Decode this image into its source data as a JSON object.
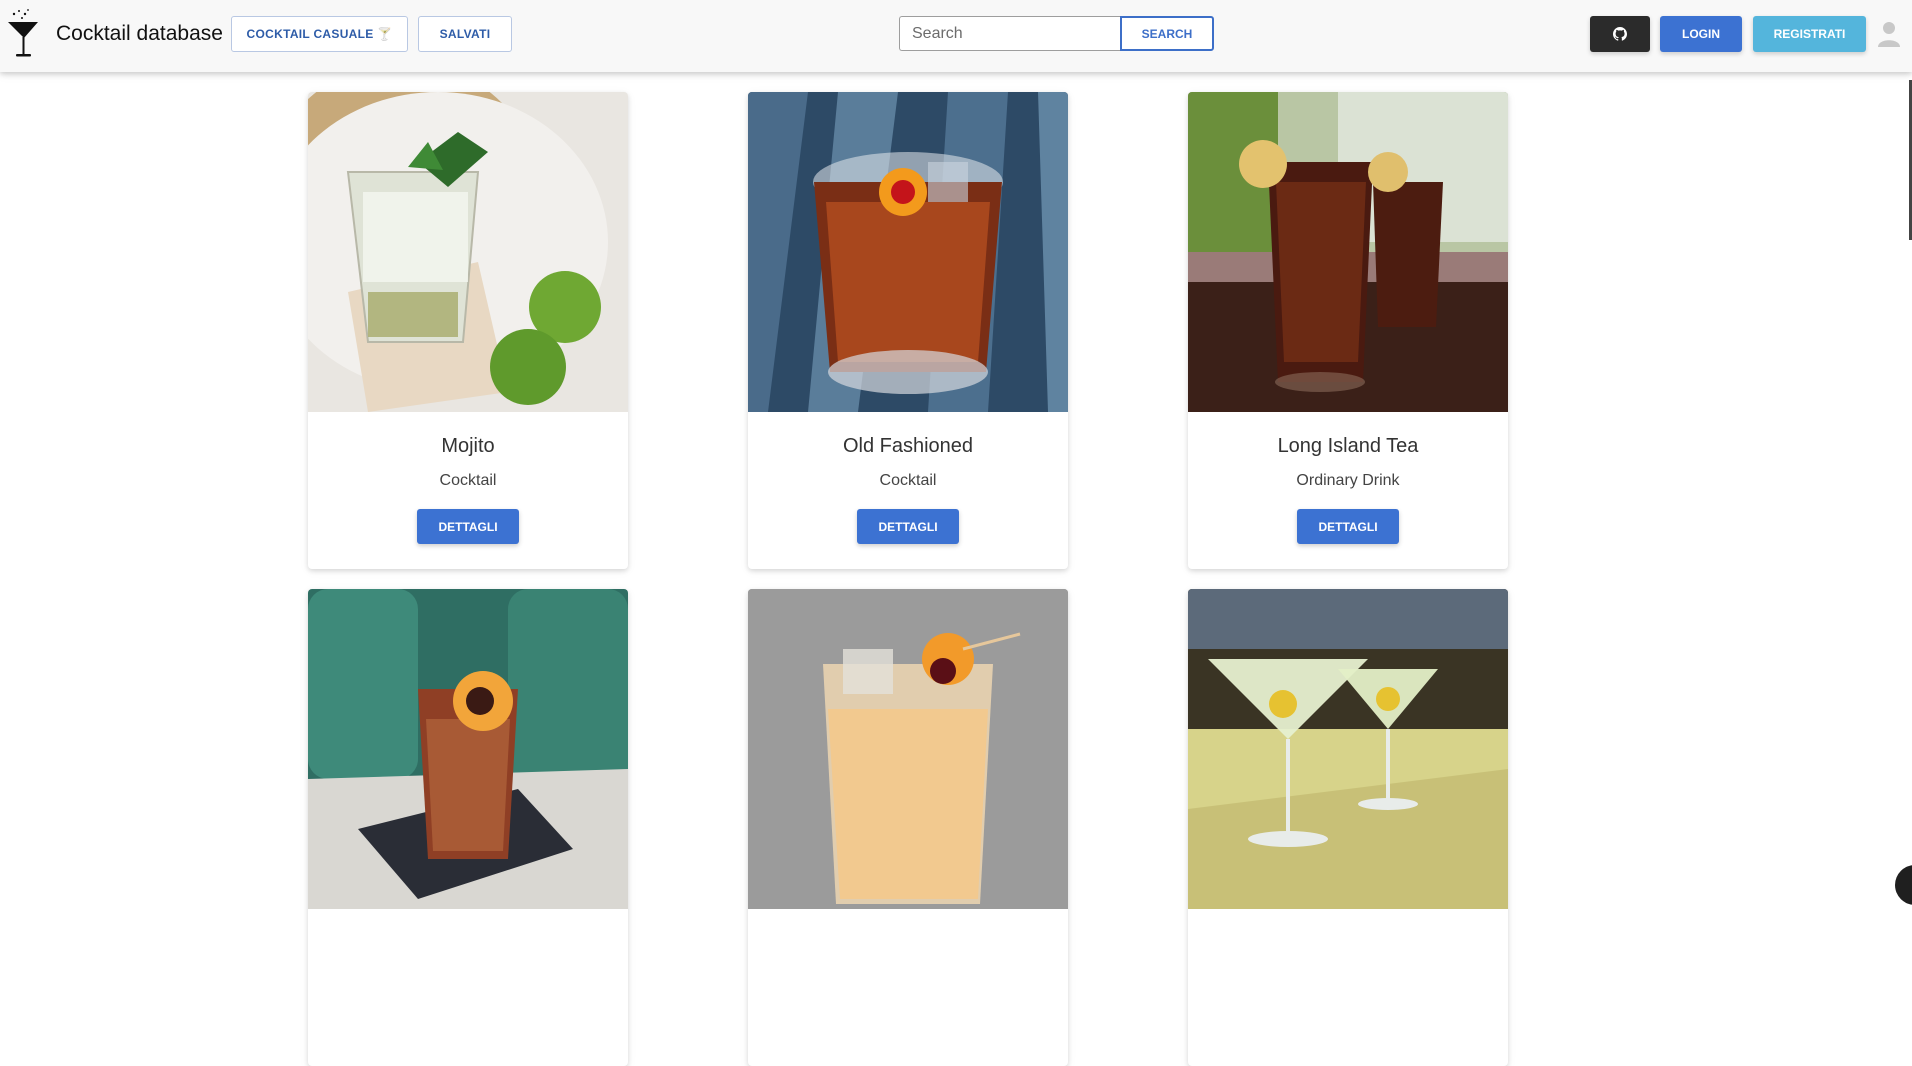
{
  "navbar": {
    "brand_title": "Cocktail database",
    "random_label": "COCKTAIL CASUALE 🍸",
    "saved_label": "SALVATI",
    "search_placeholder": "Search",
    "search_value": "",
    "search_button_label": "SEARCH",
    "github_icon": "github-icon",
    "login_label": "LOGIN",
    "register_label": "REGISTRATI"
  },
  "cards": [
    {
      "name": "Mojito",
      "category": "Cocktail",
      "button": "DETTAGLI"
    },
    {
      "name": "Old Fashioned",
      "category": "Cocktail",
      "button": "DETTAGLI"
    },
    {
      "name": "Long Island Tea",
      "category": "Ordinary Drink",
      "button": "DETTAGLI"
    }
  ],
  "colors": {
    "primary": "#3c72d2",
    "info": "#54b5dc",
    "dark": "#2b2b2b",
    "navbar_bg": "#f8f8f8"
  }
}
